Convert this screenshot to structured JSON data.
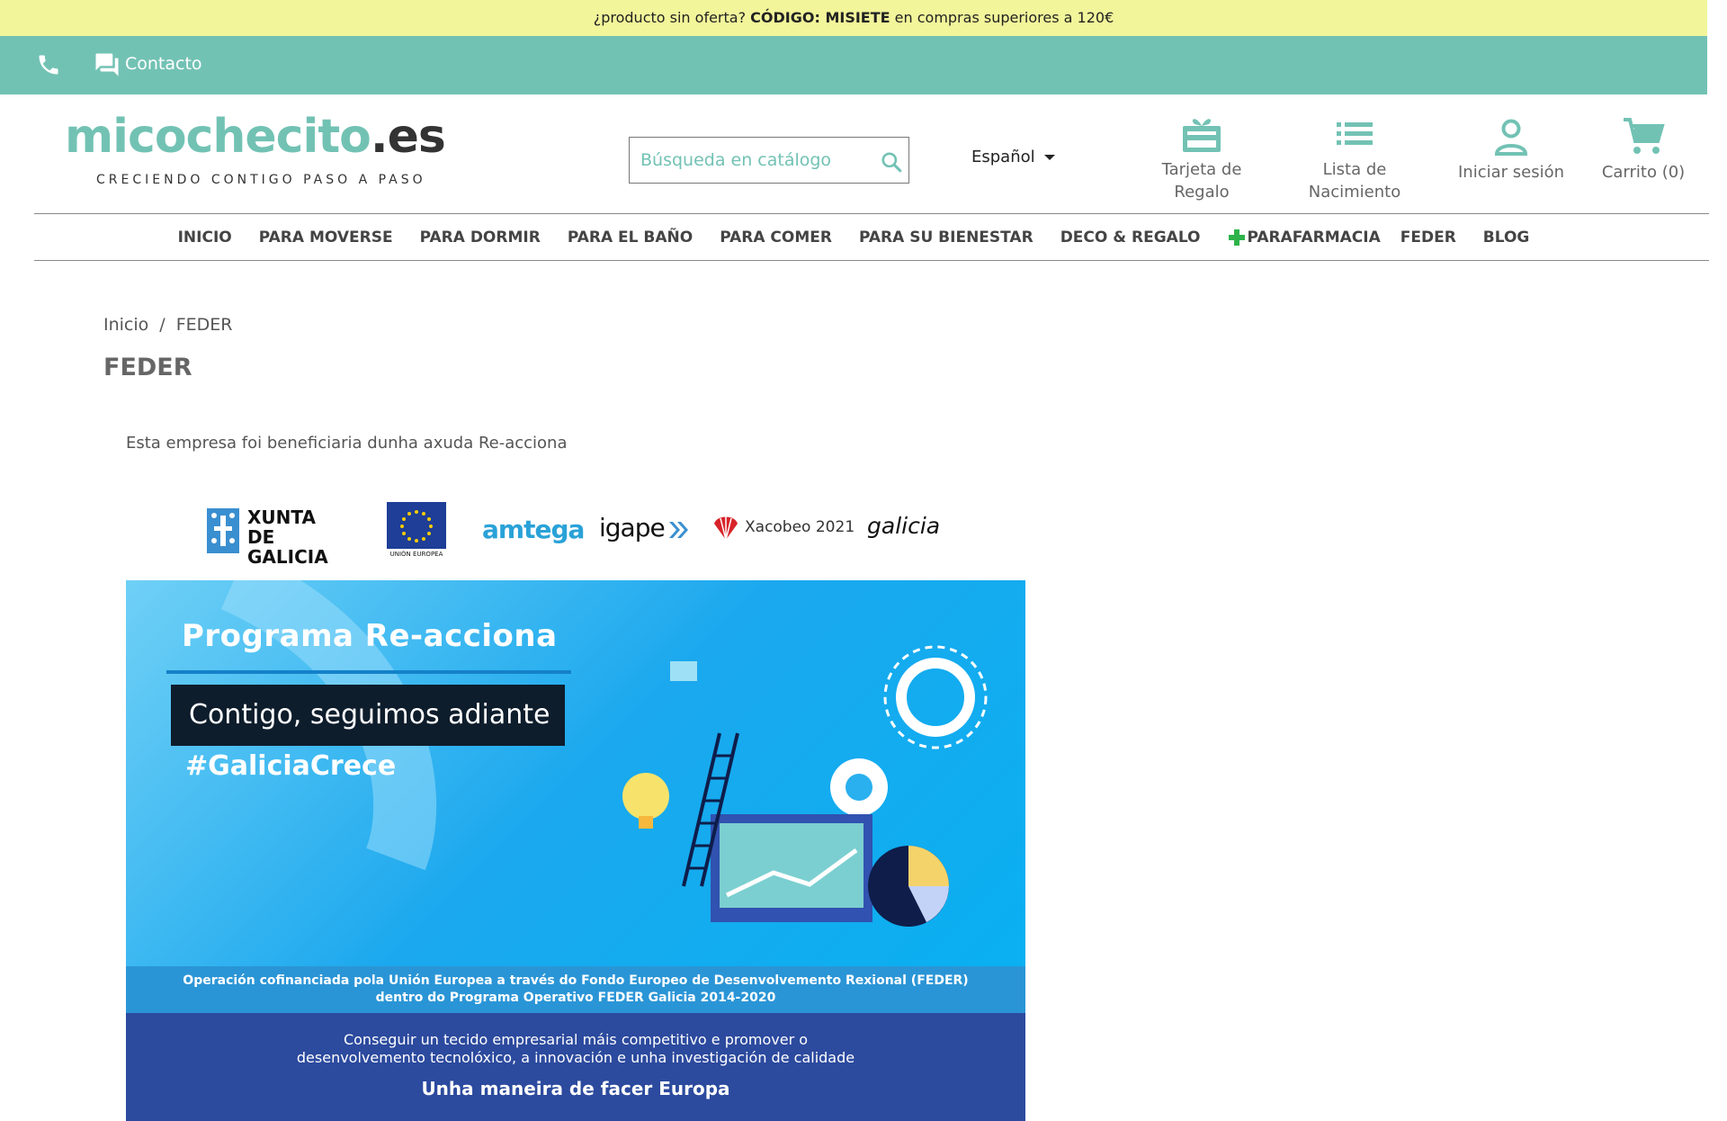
{
  "promo": {
    "prefix": "¿producto sin oferta?",
    "code": "CÓDIGO: MISIETE",
    "suffix": "en compras superiores a 120€"
  },
  "contact_bar": {
    "contact_label": "Contacto"
  },
  "header": {
    "logo_main": "micochecito",
    "logo_ext": ".es",
    "logo_tagline": "CRECIENDO CONTIGO PASO A PASO",
    "search_placeholder": "Búsqueda en catálogo",
    "language": "Español",
    "gift_card_line1": "Tarjeta de",
    "gift_card_line2": "Regalo",
    "birth_list_line1": "Lista de",
    "birth_list_line2": "Nacimiento",
    "login": "Iniciar sesión",
    "cart": "Carrito (0)"
  },
  "nav": {
    "items": [
      "INICIO",
      "PARA MOVERSE",
      "PARA DORMIR",
      "PARA EL BAÑO",
      "PARA COMER",
      "PARA SU BIENESTAR",
      "DECO & REGALO",
      "PARAFARMACIA",
      "FEDER",
      "BLOG"
    ]
  },
  "breadcrumb": {
    "home": "Inicio",
    "sep": "/",
    "current": "FEDER"
  },
  "page": {
    "title": "FEDER",
    "intro": "Esta empresa foi beneficiaria dunha axuda Re-acciona"
  },
  "logos": {
    "xunta_line1": "XUNTA",
    "xunta_line2": "DE GALICIA",
    "eu_label": "UNIÓN EUROPEA",
    "amtega": "amtega",
    "igape": "igape",
    "xacobeo": "Xacobeo 2021",
    "galicia": "galicia"
  },
  "banner": {
    "title": "Programa Re-acciona",
    "box": "Contigo, seguimos adiante",
    "hashtag": "#GaliciaCrece",
    "strip_line1": "Operación cofinanciada pola Unión Europea a través do Fondo Europeo de Desenvolvemento Rexional (FEDER)",
    "strip_line2": "dentro do Programa Operativo FEDER Galicia 2014-2020",
    "bottom_line1": "Conseguir un tecido empresarial máis competitivo e promover o",
    "bottom_line2": "desenvolvemento tecnolóxico, a innovación e unha investigación de calidade",
    "bottom_slogan": "Unha maneira de facer Europa"
  },
  "colors": {
    "accent": "#72c2b4",
    "promo_bg": "#f2f59a",
    "parafarmacia_cross": "#2db34a"
  }
}
